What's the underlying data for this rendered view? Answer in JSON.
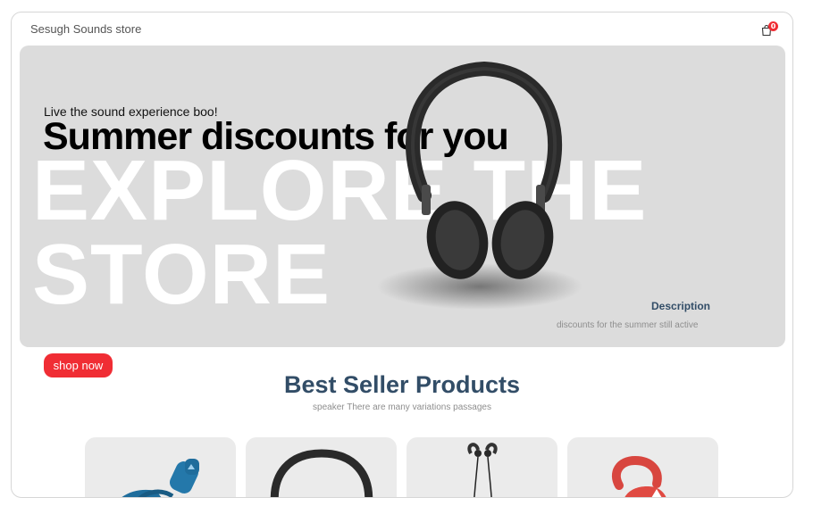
{
  "navbar": {
    "brand": "Sesugh Sounds store",
    "cart_count": "0",
    "cart_icon": "shopping-bag-icon"
  },
  "hero": {
    "small_text": "Live the sound experience boo!",
    "mid_text": "Summer discounts for you",
    "large_text": "EXPLORE THE STORE",
    "image": "headphones-image",
    "description_title": "Description",
    "description_text": "discounts for the summer still active",
    "button_label": "shop now"
  },
  "products_section": {
    "title": "Best Seller Products",
    "subtitle": "speaker There are many variations passages",
    "products": [
      {
        "image": "blue-earbuds-image"
      },
      {
        "image": "black-headphones-image"
      },
      {
        "image": "black-earphones-image"
      },
      {
        "image": "red-earbud-image"
      }
    ]
  },
  "colors": {
    "accent": "#f02d34",
    "heading": "#324d67",
    "hero_bg": "#dcdcdc",
    "card_bg": "#ebebeb"
  }
}
